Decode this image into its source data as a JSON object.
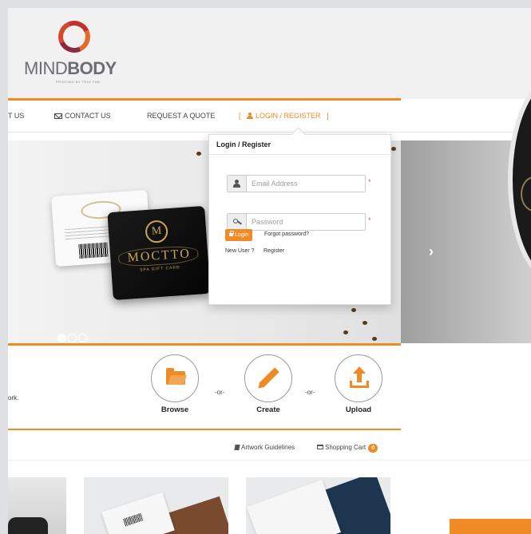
{
  "brand": {
    "name_light": "MIND",
    "name_bold": "BODY",
    "tagline": "PRINTING BY TELE FAB"
  },
  "nav": {
    "about_partial": "T US",
    "contact": "CONTACT US",
    "quote": "REQUEST A QUOTE",
    "login_bracket_open": "[",
    "login": "LOGIN / REGISTER",
    "login_bracket_close": "]"
  },
  "hero": {
    "card_brand": "MOCTTO",
    "card_monogram": "M",
    "card_sub": "SPA GIFT CARD",
    "slide_count": 3,
    "active_slide": 1
  },
  "login_panel": {
    "title": "Login / Register",
    "email_placeholder": "Email Address",
    "password_placeholder": "Password",
    "required_mark": "*",
    "login_button": "Login",
    "forgot": "Forgot password?",
    "new_user": "New User ?",
    "register": "Register"
  },
  "actions": {
    "work_text_partial": "ork.",
    "or": "-or-",
    "browse": "Browse",
    "create": "Create",
    "upload": "Upload"
  },
  "toolbar": {
    "guidelines": "Artwork Guidelines",
    "cart": "Shopping Cart",
    "cart_count": "0"
  },
  "colors": {
    "accent": "#f08a24",
    "required": "#d9534f"
  }
}
